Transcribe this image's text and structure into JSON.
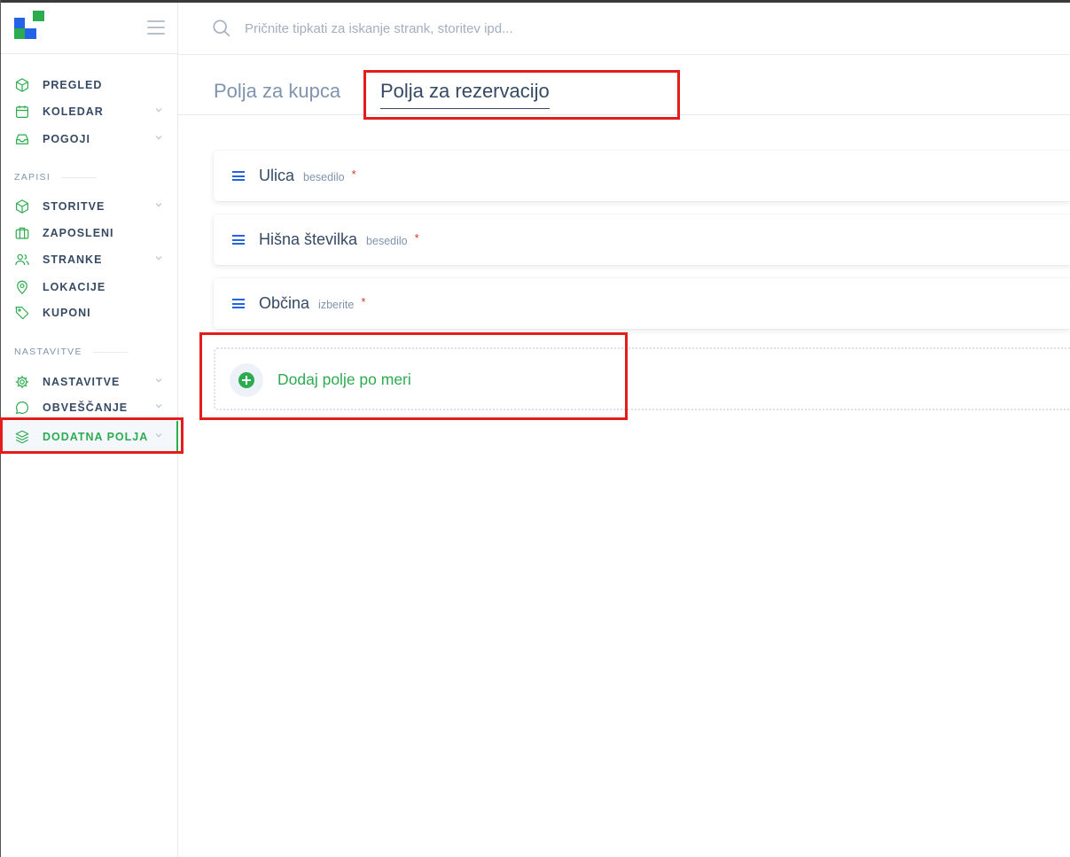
{
  "header": {
    "search_placeholder": "Pričnite tipkati za iskanje strank, storitev ipd..."
  },
  "sidebar": {
    "top_items": [
      {
        "label": "PREGLED",
        "icon": "cube-icon",
        "has_chevron": false
      },
      {
        "label": "KOLEDAR",
        "icon": "calendar-icon",
        "has_chevron": true
      },
      {
        "label": "POGOJI",
        "icon": "inbox-icon",
        "has_chevron": true
      }
    ],
    "section_records": "ZAPISI",
    "record_items": [
      {
        "label": "STORITVE",
        "icon": "cube-icon",
        "has_chevron": true
      },
      {
        "label": "ZAPOSLENI",
        "icon": "briefcase-icon",
        "has_chevron": false
      },
      {
        "label": "STRANKE",
        "icon": "users-icon",
        "has_chevron": true
      },
      {
        "label": "LOKACIJE",
        "icon": "map-pin-icon",
        "has_chevron": false
      },
      {
        "label": "KUPONI",
        "icon": "tag-icon",
        "has_chevron": false
      }
    ],
    "section_settings": "NASTAVITVE",
    "settings_items": [
      {
        "label": "NASTAVITVE",
        "icon": "gear-icon",
        "has_chevron": true
      },
      {
        "label": "OBVEŠČANJE",
        "icon": "chat-bubble-icon",
        "has_chevron": true
      },
      {
        "label": "DODATNA POLJA",
        "icon": "layers-icon",
        "has_chevron": true,
        "active": true
      }
    ]
  },
  "tabs": [
    {
      "label": "Polja za kupca",
      "active": false
    },
    {
      "label": "Polja za rezervacijo",
      "active": true
    }
  ],
  "fields": [
    {
      "name": "Ulica",
      "type": "besedilo",
      "required_mark": "*"
    },
    {
      "name": "Hišna številka",
      "type": "besedilo",
      "required_mark": "*"
    },
    {
      "name": "Občina",
      "type": "izberite",
      "required_mark": "*"
    }
  ],
  "add_field": {
    "label": "Dodaj polje po meri"
  },
  "colors": {
    "accent_green": "#2dab4f",
    "accent_blue": "#2463e8",
    "text_dark": "#364a63",
    "text_muted": "#8094ae",
    "highlight_red": "#e41c1c"
  }
}
